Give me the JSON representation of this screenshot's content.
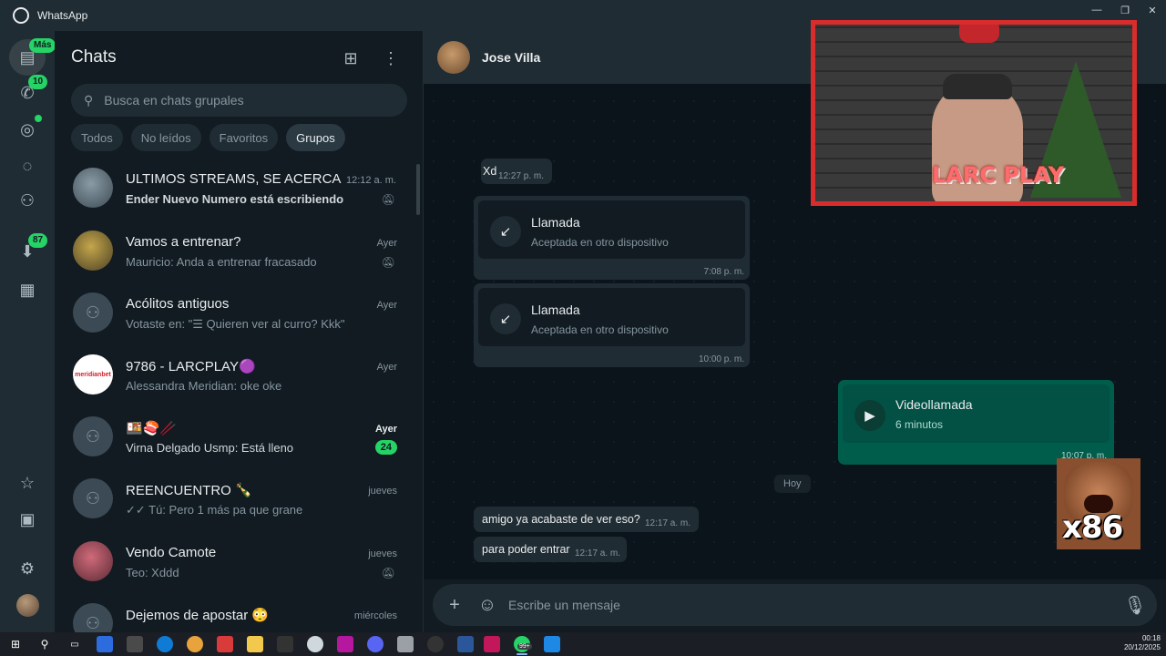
{
  "window": {
    "title": "WhatsApp",
    "controls": [
      "—",
      "❐",
      "✕"
    ]
  },
  "rail": {
    "top": [
      {
        "name": "chats",
        "icon": "chats-icon",
        "badge": "Más"
      },
      {
        "name": "calls",
        "icon": "phone-icon",
        "badge": "10"
      },
      {
        "name": "status",
        "icon": "status-icon",
        "badge": ""
      },
      {
        "name": "channels",
        "icon": "channels-icon",
        "badge": ""
      },
      {
        "name": "communities",
        "icon": "communities-icon",
        "badge": ""
      },
      {
        "name": "archived",
        "icon": "archive-icon",
        "badge": "87"
      },
      {
        "name": "store",
        "icon": "store-icon",
        "badge": ""
      }
    ],
    "bottom": [
      {
        "name": "starred",
        "icon": "starred-icon"
      },
      {
        "name": "media",
        "icon": "media-icon"
      },
      {
        "name": "settings",
        "icon": "settings-icon"
      },
      {
        "name": "profile",
        "icon": "profile-avatar"
      }
    ]
  },
  "list": {
    "title": "Chats",
    "search_placeholder": "Busca en chats grupales",
    "filters": [
      "Todos",
      "No leídos",
      "Favoritos",
      "Grupos"
    ],
    "active_filter": "Grupos",
    "chats": [
      {
        "name": "ULTIMOS STREAMS, SE ACERCA EL...",
        "time": "12:12 a. m.",
        "preview": "Ender Nuevo Numero está escribiendo...",
        "muted": true,
        "unread": "",
        "preview_bold": true
      },
      {
        "name": "Vamos a entrenar?",
        "time": "Ayer",
        "preview": "Mauricio: Anda a entrenar fracasado",
        "muted": true,
        "unread": ""
      },
      {
        "name": "Acólitos antiguos",
        "time": "Ayer",
        "preview": "Votaste en: \"☰ Quieren ver al curro? Kkk\"",
        "muted": false,
        "unread": ""
      },
      {
        "name": "9786 - LARCPLAY🟣",
        "time": "Ayer",
        "preview": "Alessandra Meridian: oke oke",
        "muted": false,
        "unread": "",
        "avatar_text": "meridianbet"
      },
      {
        "name": "🍱🍣🥢",
        "time": "Ayer",
        "preview": "Virna Delgado Usmp: Está lleno",
        "muted": false,
        "unread": "24"
      },
      {
        "name": "REENCUENTRO 🍾",
        "time": "jueves",
        "preview": "✓✓ Tú: Pero 1 más pa que grane",
        "muted": false,
        "unread": ""
      },
      {
        "name": "Vendo Camote",
        "time": "jueves",
        "preview": "Teo: Xddd",
        "muted": true,
        "unread": ""
      },
      {
        "name": "Dejemos de apostar 😳",
        "time": "miércoles",
        "preview": "",
        "muted": false,
        "unread": ""
      }
    ]
  },
  "conversation": {
    "contact": "Jose Villa",
    "messages": [
      {
        "text": "Xd",
        "time": "12:27 p. m."
      },
      {
        "call_title": "Llamada",
        "call_sub": "Aceptada en otro dispositivo",
        "time": "7:08 p. m."
      },
      {
        "call_title": "Llamada",
        "call_sub": "Aceptada en otro dispositivo",
        "time": "10:00 p. m."
      },
      {
        "call_title": "Videollamada",
        "call_sub": "6 minutos",
        "time": "10:07 p. m."
      },
      {
        "text": "amigo ya acabaste de ver eso?",
        "time": "12:17 a. m."
      },
      {
        "text": "para poder entrar",
        "time": "12:17 a. m."
      }
    ],
    "day_label": "Hoy",
    "composer_placeholder": "Escribe un mensaje"
  },
  "overlay": {
    "cam_logo": "LARC PLAY",
    "meme_text": "x86"
  },
  "taskbar": {
    "time": "00:18",
    "date": "20/12/2025",
    "whatsapp_badge": "99+"
  },
  "colors": {
    "accent": "#25d366",
    "outgoing": "#005c4b",
    "panel": "#202c33",
    "background": "#0b141a"
  }
}
